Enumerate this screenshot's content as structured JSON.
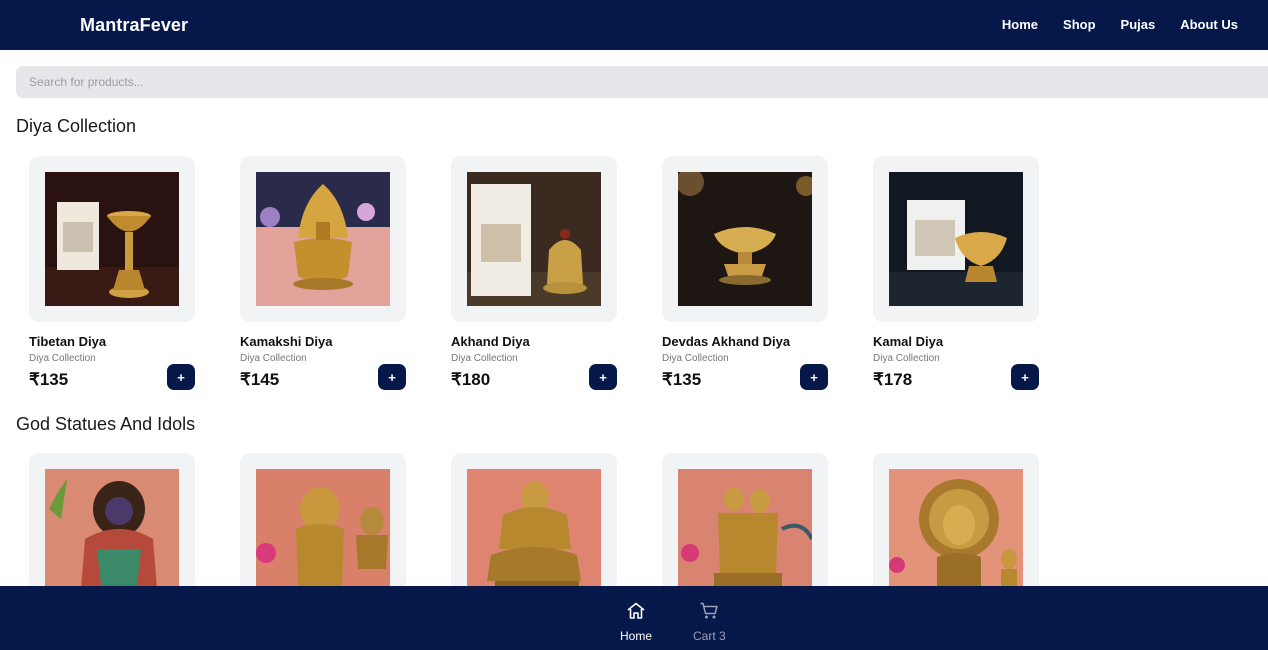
{
  "header": {
    "brand": "MantraFever",
    "nav": [
      "Home",
      "Shop",
      "Pujas",
      "About Us"
    ]
  },
  "search": {
    "placeholder": "Search for products..."
  },
  "sections": [
    {
      "title": "Diya Collection",
      "products": [
        {
          "name": "Tibetan Diya",
          "category": "Diya Collection",
          "price": "₹135",
          "add": "+"
        },
        {
          "name": "Kamakshi Diya",
          "category": "Diya Collection",
          "price": "₹145",
          "add": "+"
        },
        {
          "name": "Akhand Diya",
          "category": "Diya Collection",
          "price": "₹180",
          "add": "+"
        },
        {
          "name": "Devdas Akhand Diya",
          "category": "Diya Collection",
          "price": "₹135",
          "add": "+"
        },
        {
          "name": "Kamal Diya",
          "category": "Diya Collection",
          "price": "₹178",
          "add": "+"
        }
      ]
    },
    {
      "title": "God Statues And Idols"
    }
  ],
  "bottom_nav": {
    "home": "Home",
    "cart": "Cart 3"
  },
  "colors": {
    "navy": "#06174a",
    "card_bg": "#f2f3f5",
    "search_bg": "#e6e7ea"
  }
}
